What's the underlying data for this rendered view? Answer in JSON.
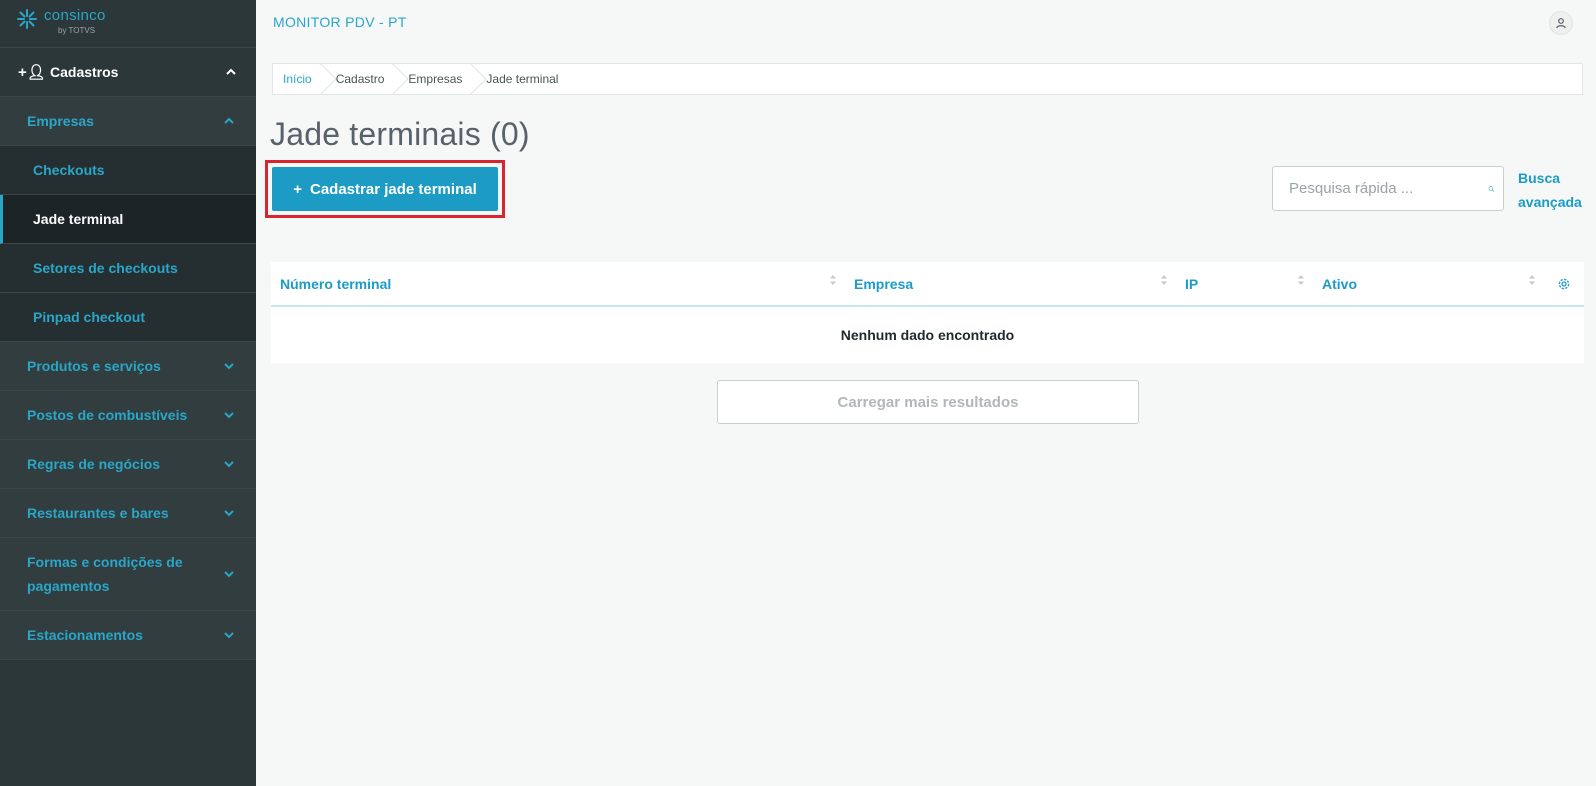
{
  "app": {
    "logo_name": "consinco",
    "logo_by": "by TOTVS",
    "title": "MONITOR PDV - PT"
  },
  "sidebar": {
    "section": "Cadastros",
    "group": "Empresas",
    "children": [
      "Checkouts",
      "Jade terminal",
      "Setores de checkouts",
      "Pinpad checkout"
    ],
    "active_child": "Jade terminal",
    "groups": [
      "Produtos e serviços",
      "Postos de combustíveis",
      "Regras de negócios",
      "Restaurantes e bares",
      "Formas e condições de pagamentos",
      "Estacionamentos"
    ]
  },
  "breadcrumb": [
    "Início",
    "Cadastro",
    "Empresas",
    "Jade terminal"
  ],
  "page": {
    "title": "Jade terminais (0)",
    "add_button": "Cadastrar jade terminal",
    "add_button_icon": "+",
    "search_placeholder": "Pesquisa rápida ...",
    "advanced_search": "Busca avançada"
  },
  "table": {
    "columns": [
      "Número terminal",
      "Empresa",
      "IP",
      "Ativo"
    ],
    "empty_message": "Nenhum dado encontrado"
  },
  "load_more": "Carregar mais resultados",
  "colors": {
    "sidebar_bg": "#2c3739",
    "accent": "#1c9cc4",
    "highlight": "#d9262e"
  }
}
